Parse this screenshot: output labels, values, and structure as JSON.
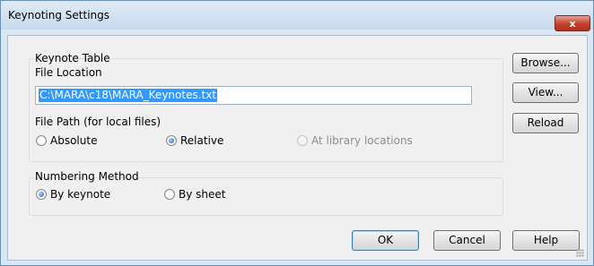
{
  "window": {
    "title": "Keynoting Settings",
    "close_label": "x"
  },
  "keynote_table": {
    "group_label": "Keynote Table",
    "file_location_label": "File Location",
    "file_location_value": "C:\\MARA\\c18\\MARA_Keynotes.txt",
    "file_path_label": "File Path (for local files)",
    "options": [
      {
        "label": "Absolute",
        "selected": false,
        "enabled": true
      },
      {
        "label": "Relative",
        "selected": true,
        "enabled": true
      },
      {
        "label": "At library locations",
        "selected": false,
        "enabled": false
      }
    ]
  },
  "numbering": {
    "group_label": "Numbering Method",
    "options": [
      {
        "label": "By keynote",
        "selected": true
      },
      {
        "label": "By sheet",
        "selected": false
      }
    ]
  },
  "side_buttons": {
    "browse": "Browse...",
    "view": "View...",
    "reload": "Reload"
  },
  "footer_buttons": {
    "ok": "OK",
    "cancel": "Cancel",
    "help": "Help"
  }
}
